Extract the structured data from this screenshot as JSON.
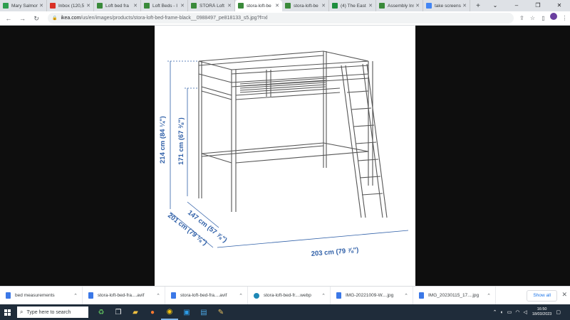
{
  "tabs": [
    {
      "label": "Mary Salmon",
      "color": "#2e9e4f",
      "active": false
    },
    {
      "label": "Inbox (120,5",
      "color": "#d93025",
      "active": false
    },
    {
      "label": "Loft bed fra",
      "color": "#3a8a3a",
      "active": false
    },
    {
      "label": "Loft Beds - I",
      "color": "#3a8a3a",
      "active": false
    },
    {
      "label": "STORÅ Loft",
      "color": "#3a8a3a",
      "active": false
    },
    {
      "label": "stora-loft-be",
      "color": "#3a8a3a",
      "active": true
    },
    {
      "label": "stora-loft-be",
      "color": "#3a8a3a",
      "active": false
    },
    {
      "label": "(4) The East",
      "color": "#1e8e3e",
      "active": false
    },
    {
      "label": "Assembly Ins",
      "color": "#3a8a3a",
      "active": false
    },
    {
      "label": "take screens",
      "color": "#4285f4",
      "active": false
    }
  ],
  "window_controls": {
    "minimize": "–",
    "restore": "❐",
    "close": "✕"
  },
  "address": {
    "host": "ikea.com",
    "path": "/us/en/images/products/stora-loft-bed-frame-black__0988497_pe818133_s5.jpg?f=xl"
  },
  "dimensions": {
    "total_height": "214 cm (84 ¼\")",
    "under_bed_height": "171 cm (67 ⅜\")",
    "width": "147 cm (57 ⅞\")",
    "depth": "201 cm (79 ⅛\")",
    "length": "203 cm (79 ⅞\")"
  },
  "downloads": [
    {
      "name": "bed measurements",
      "icon": "file-icon"
    },
    {
      "name": "stora-loft-bed-fra....avif",
      "icon": "file-icon"
    },
    {
      "name": "stora-loft-bed-fra....avif",
      "icon": "file-icon"
    },
    {
      "name": "stora-loft-bed-fr....webp",
      "icon": "edge-icon"
    },
    {
      "name": "IMG-20221009-W....jpg",
      "icon": "file-icon"
    },
    {
      "name": "IMG_20230115_17....jpg",
      "icon": "file-icon"
    }
  ],
  "downloads_show_all": "Show all",
  "taskbar": {
    "search_placeholder": "Type here to search",
    "time": "16:50",
    "date": "18/03/2023"
  },
  "colors": {
    "dimension_blue": "#3060a8",
    "drawing_line": "#555555",
    "taskbar_bg": "#1f2c3a"
  }
}
